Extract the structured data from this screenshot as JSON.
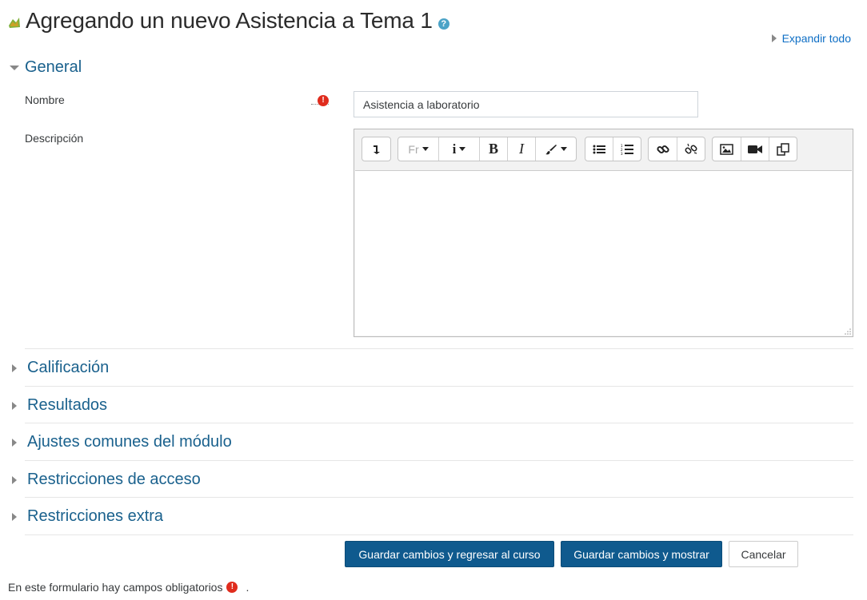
{
  "header": {
    "title": "Agregando un nuevo Asistencia a Tema 1",
    "module_icon": "attendance-icon",
    "help_icon": "help-icon",
    "help_glyph": "?"
  },
  "expand_all_label": "Expandir todo",
  "sections": {
    "general": "General",
    "calificacion": "Calificación",
    "resultados": "Resultados",
    "ajustes": "Ajustes comunes del módulo",
    "restricciones_acceso": "Restricciones de acceso",
    "restricciones_extra": "Restricciones extra"
  },
  "form": {
    "nombre_label": "Nombre",
    "nombre_value": "Asistencia a laboratorio",
    "descripcion_label": "Descripción",
    "required_glyph": "!"
  },
  "editor": {
    "toolbar": {
      "groups": [
        [
          "toggle-toolbar-icon"
        ],
        [
          "font-family-icon",
          "info-icon",
          "bold-icon",
          "italic-icon",
          "brush-icon"
        ],
        [
          "bullet-list-icon",
          "numbered-list-icon"
        ],
        [
          "link-icon",
          "unlink-icon"
        ],
        [
          "image-icon",
          "video-icon",
          "copy-icon"
        ]
      ],
      "font_family_label": "Fr",
      "info_label": "i",
      "bold_label": "B",
      "italic_label": "I"
    },
    "content": ""
  },
  "buttons": {
    "save_return": "Guardar cambios y regresar al curso",
    "save_display": "Guardar cambios y mostrar",
    "cancel": "Cancelar"
  },
  "footer": {
    "required_note": "En este formulario hay campos obligatorios",
    "period": "."
  },
  "colors": {
    "link": "#0f6fc5",
    "section_title": "#1a618d",
    "primary_button": "#0f5a8e",
    "required": "#e02c1d",
    "help": "#4ba3c7"
  }
}
